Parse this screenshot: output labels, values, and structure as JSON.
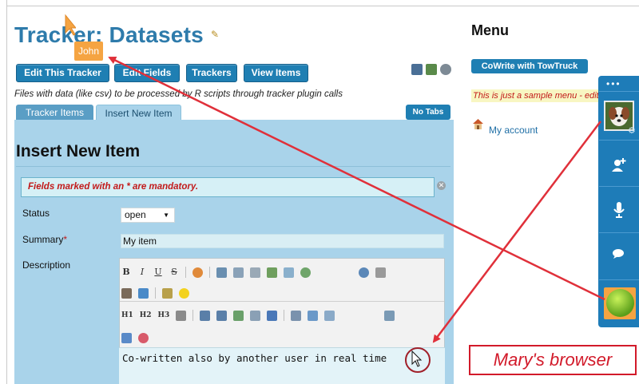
{
  "page": {
    "title": "Tracker: Datasets",
    "description": "Files with data (like csv) to be processed by R scripts through tracker plugin calls"
  },
  "toolbar": {
    "edit_tracker": "Edit This Tracker",
    "edit_fields": "Edit Fields",
    "trackers": "Trackers",
    "view_items": "View Items",
    "icons": [
      "save-icon",
      "export-icon",
      "watch-icon"
    ]
  },
  "tabs": [
    {
      "label": "Tracker Items",
      "active": false
    },
    {
      "label": "Insert New Item",
      "active": true
    }
  ],
  "no_tabs_label": "No Tabs",
  "form": {
    "heading": "Insert New Item",
    "notice": "Fields marked with an * are mandatory.",
    "status_label": "Status",
    "status_value": "open",
    "summary_label": "Summary",
    "required_marker": "*",
    "summary_value": "My item",
    "description_label": "Description",
    "description_value": "Co-written also by another user in real time"
  },
  "editor_toolbar": {
    "row1": [
      "B",
      "I",
      "U",
      "S"
    ],
    "row3": [
      "H1",
      "H2",
      "H3"
    ]
  },
  "collab": {
    "remote_cursor_label": "John"
  },
  "sidebar": {
    "menu_title": "Menu",
    "cowrite_button": "CoWrite with TowTruck",
    "sample_menu": "This is just a sample menu - edit it",
    "my_account": "My account"
  },
  "towtruck": {
    "dots": "•••"
  },
  "annotation": {
    "label": "Mary's browser"
  },
  "colors": {
    "accent": "#1f7fb3",
    "title": "#2e7bab",
    "panel": "#a9d3ea",
    "error": "#c21a1a",
    "remote_cursor": "#f5a442",
    "annotation": "#d21a2a"
  }
}
